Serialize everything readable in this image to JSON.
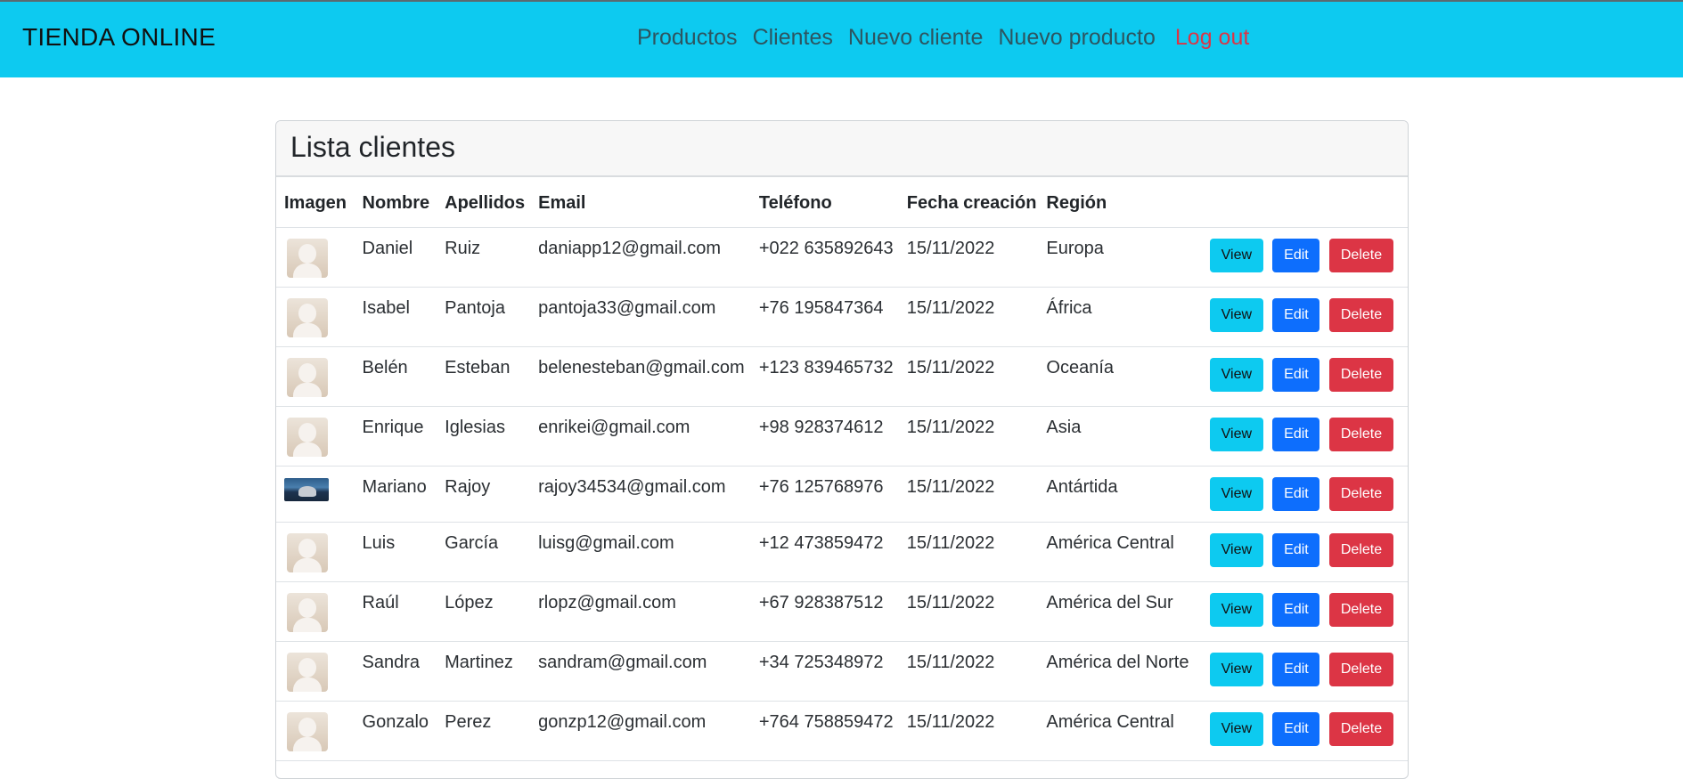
{
  "header": {
    "brand": "TIENDA ONLINE",
    "nav": [
      "Productos",
      "Clientes",
      "Nuevo cliente",
      "Nuevo producto"
    ],
    "logout": "Log out",
    "bg_color": "#0dcaf0",
    "logout_color": "#dc3545"
  },
  "card": {
    "title": "Lista clientes"
  },
  "table": {
    "columns": [
      "Imagen",
      "Nombre",
      "Apellidos",
      "Email",
      "Teléfono",
      "Fecha creación",
      "Región"
    ],
    "actions": {
      "view": "View",
      "edit": "Edit",
      "delete": "Delete"
    },
    "rows": [
      {
        "image": "avatar-placeholder",
        "nombre": "Daniel",
        "apellidos": "Ruiz",
        "email": "daniapp12@gmail.com",
        "telefono": "+022 635892643",
        "fecha": "15/11/2022",
        "region": "Europa"
      },
      {
        "image": "avatar-placeholder",
        "nombre": "Isabel",
        "apellidos": "Pantoja",
        "email": "pantoja33@gmail.com",
        "telefono": "+76 195847364",
        "fecha": "15/11/2022",
        "region": "África"
      },
      {
        "image": "avatar-placeholder",
        "nombre": "Belén",
        "apellidos": "Esteban",
        "email": "belenesteban@gmail.com",
        "telefono": "+123 839465732",
        "fecha": "15/11/2022",
        "region": "Oceanía"
      },
      {
        "image": "avatar-placeholder",
        "nombre": "Enrique",
        "apellidos": "Iglesias",
        "email": "enrikei@gmail.com",
        "telefono": "+98 928374612",
        "fecha": "15/11/2022",
        "region": "Asia"
      },
      {
        "image": "photo",
        "nombre": "Mariano",
        "apellidos": "Rajoy",
        "email": "rajoy34534@gmail.com",
        "telefono": "+76 125768976",
        "fecha": "15/11/2022",
        "region": "Antártida"
      },
      {
        "image": "avatar-placeholder",
        "nombre": "Luis",
        "apellidos": "García",
        "email": "luisg@gmail.com",
        "telefono": "+12 473859472",
        "fecha": "15/11/2022",
        "region": "América Central"
      },
      {
        "image": "avatar-placeholder",
        "nombre": "Raúl",
        "apellidos": "López",
        "email": "rlopz@gmail.com",
        "telefono": "+67 928387512",
        "fecha": "15/11/2022",
        "region": "América del Sur"
      },
      {
        "image": "avatar-placeholder",
        "nombre": "Sandra",
        "apellidos": "Martinez",
        "email": "sandram@gmail.com",
        "telefono": "+34 725348972",
        "fecha": "15/11/2022",
        "region": "América del Norte"
      },
      {
        "image": "avatar-placeholder",
        "nombre": "Gonzalo",
        "apellidos": "Perez",
        "email": "gonzp12@gmail.com",
        "telefono": "+764 758859472",
        "fecha": "15/11/2022",
        "region": "América Central"
      }
    ]
  }
}
